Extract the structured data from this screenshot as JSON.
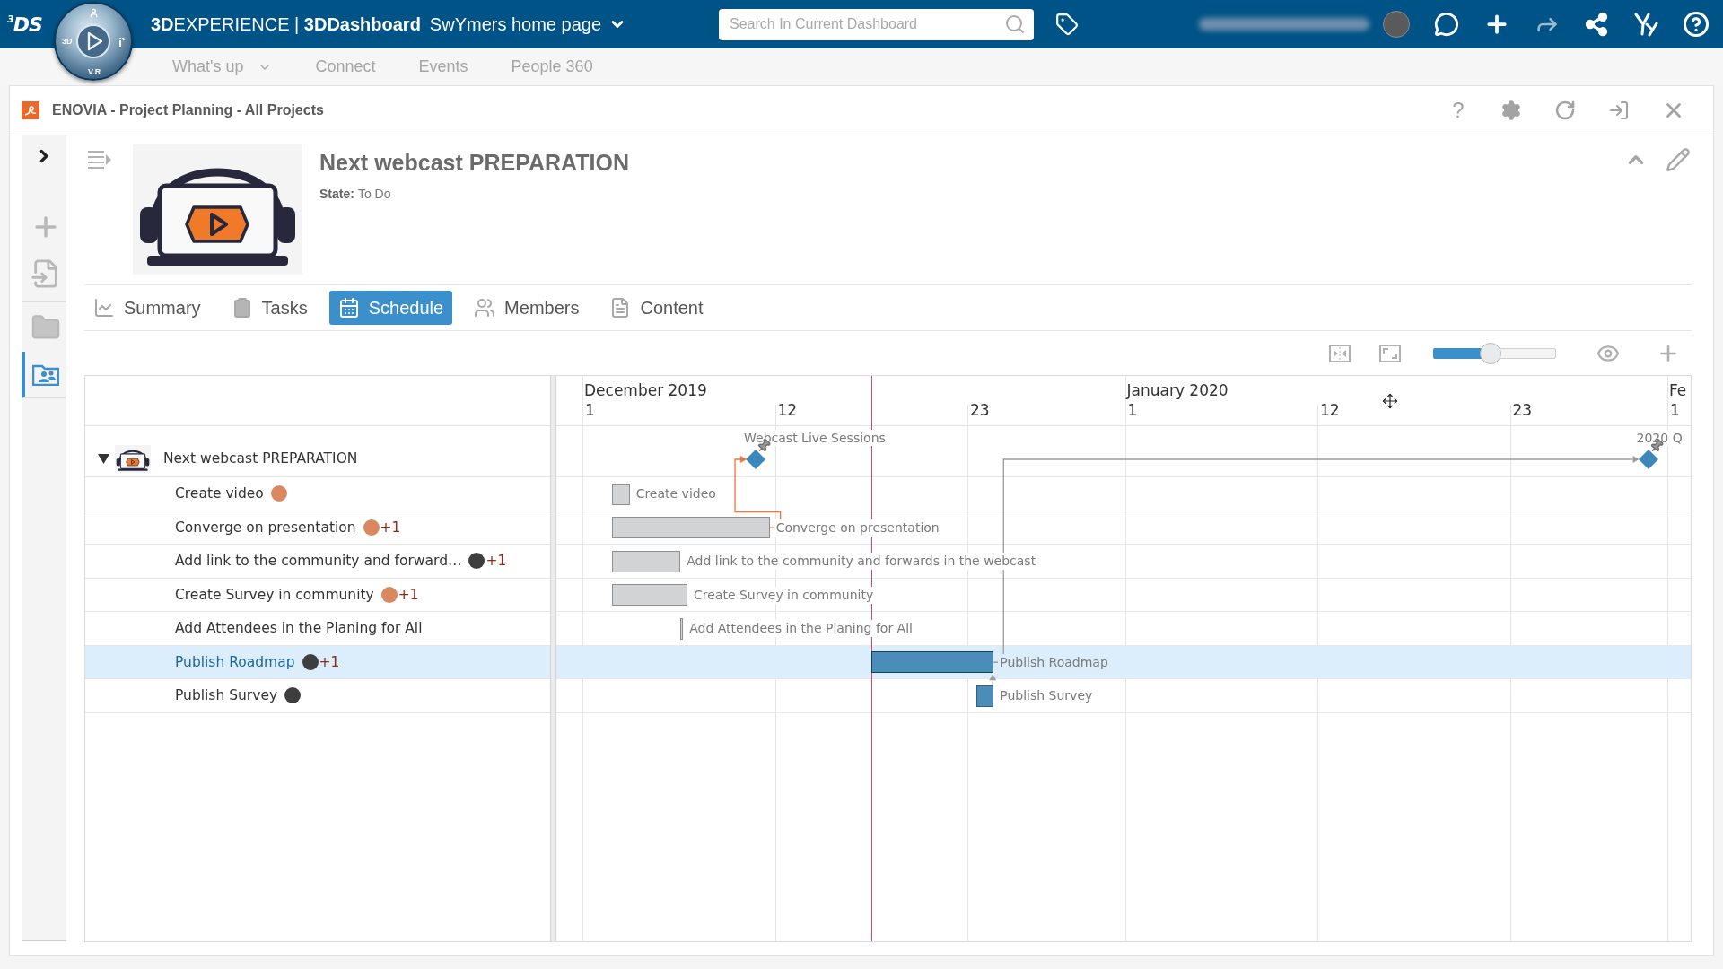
{
  "topbar": {
    "logo": "$^{3}$DS",
    "compass_labels": [
      "3D",
      "V.R"
    ],
    "brand": "**3D**EXPERIENCE | **3DDashboard**",
    "dashboard": "SwYmers home page",
    "search": {
      "placeholder": "Search In Current Dashboard"
    }
  },
  "dashboard_tabs": [
    {
      "label": "What's up",
      "dropdown": true
    },
    {
      "label": "Connect",
      "dropdown": false
    },
    {
      "label": "Events",
      "dropdown": false
    },
    {
      "label": "People 360",
      "dropdown": false
    }
  ],
  "widget": {
    "title": "ENOVIA - Project Planning - All Projects",
    "help": "?"
  },
  "sidebar": {
    "items": [
      {
        "selected": false
      },
      {
        "selected": false
      },
      {
        "selected": false
      },
      {
        "selected": true
      }
    ]
  },
  "project": {
    "title": "Next webcast PREPARATION",
    "state_label": "State:",
    "state": "To Do"
  },
  "tabs": [
    {
      "label": "Summary",
      "selected": false
    },
    {
      "label": "Tasks",
      "selected": false
    },
    {
      "label": "Schedule",
      "selected": true
    },
    {
      "label": "Members",
      "selected": false
    },
    {
      "label": "Content",
      "selected": false
    }
  ],
  "schedule": {
    "zoom": {
      "level": 0.47
    },
    "timeline": {
      "months": [
        "December 2019",
        "January 2020",
        "Fe"
      ],
      "days": [
        "1",
        "12",
        "23",
        "1",
        "12",
        "23",
        "1"
      ]
    },
    "tree": [
      {
        "name": "Next webcast PREPARATION",
        "expanded": true,
        "selected": false,
        "milestones": [
          "Webcast Live Sessions",
          "2020 Q"
        ],
        "children": [
          {
            "name": "Create video",
            "selected": false,
            "color": "#d1d3d4",
            "assignees": [
              {
                "color": "#d9885f"
              }
            ],
            "bar_label": "Create video"
          },
          {
            "name": "Converge on presentation",
            "selected": false,
            "color": "#d1d3d4",
            "assignees": [
              {
                "color": "#d9885f"
              }
            ],
            "more": "+1",
            "bar_label": "Converge on presentation"
          },
          {
            "name": "Add link to the community and forward…",
            "selected": false,
            "color": "#d1d3d4",
            "assignees": [
              {
                "color": "#3e3e3e"
              }
            ],
            "more": "+1",
            "bar_label": "Add link to the community and forwards in the webcast"
          },
          {
            "name": "Create Survey in community",
            "selected": false,
            "color": "#d1d3d4",
            "assignees": [
              {
                "color": "#d9885f"
              }
            ],
            "more": "+1",
            "bar_label": "Create Survey in community"
          },
          {
            "name": "Add Attendees in the Planing for All",
            "selected": false,
            "color": "#d1d3d4",
            "bar_label": "Add Attendees in the Planing for All"
          },
          {
            "name": "Publish Roadmap",
            "selected": true,
            "color": "#4a8db8",
            "assignees": [
              {
                "color": "#3e3e3e"
              }
            ],
            "more": "+1",
            "bar_label": "Publish Roadmap"
          },
          {
            "name": "Publish Survey",
            "selected": false,
            "color": "#4a8db8",
            "assignees": [
              {
                "color": "#3e3e3e"
              }
            ],
            "bar_label": "Publish Survey"
          }
        ]
      }
    ],
    "dependencies": [
      {
        "kind": "critical"
      },
      {
        "kind": "normal"
      },
      {
        "kind": "normal"
      }
    ]
  }
}
